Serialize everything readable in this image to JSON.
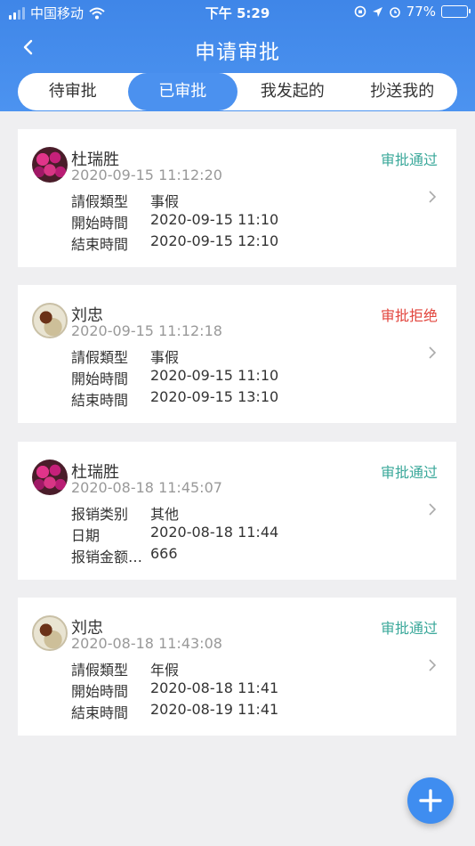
{
  "status_bar": {
    "carrier": "中国移动",
    "time": "下午 5:29",
    "battery": "77%",
    "battery_level": 0.77
  },
  "navbar": {
    "title": "申请审批"
  },
  "tabs": [
    {
      "label": "待审批",
      "active": false
    },
    {
      "label": "已审批",
      "active": true
    },
    {
      "label": "我发起的",
      "active": false
    },
    {
      "label": "抄送我的",
      "active": false
    }
  ],
  "cards": [
    {
      "name": "杜瑞胜",
      "time": "2020-09-15 11:12:20",
      "status": "审批通过",
      "status_type": "ok",
      "avatar": "flower",
      "rows": [
        {
          "k": "請假類型",
          "v": "事假"
        },
        {
          "k": "開始時間",
          "v": "2020-09-15 11:10"
        },
        {
          "k": "結束時間",
          "v": "2020-09-15 12:10"
        }
      ]
    },
    {
      "name": "刘忠",
      "time": "2020-09-15 11:12:18",
      "status": "审批拒绝",
      "status_type": "reject",
      "avatar": "dog",
      "rows": [
        {
          "k": "請假類型",
          "v": "事假"
        },
        {
          "k": "開始時間",
          "v": "2020-09-15 11:10"
        },
        {
          "k": "結束時間",
          "v": "2020-09-15 13:10"
        }
      ]
    },
    {
      "name": "杜瑞胜",
      "time": "2020-08-18 11:45:07",
      "status": "审批通过",
      "status_type": "ok",
      "avatar": "flower",
      "rows": [
        {
          "k": "报销类别",
          "v": "其他"
        },
        {
          "k": "日期",
          "v": "2020-08-18 11:44"
        },
        {
          "k": "报销金额…",
          "v": "666"
        }
      ]
    },
    {
      "name": "刘忠",
      "time": "2020-08-18 11:43:08",
      "status": "审批通过",
      "status_type": "ok",
      "avatar": "dog",
      "rows": [
        {
          "k": "請假類型",
          "v": "年假"
        },
        {
          "k": "開始時間",
          "v": "2020-08-18 11:41"
        },
        {
          "k": "結束時間",
          "v": "2020-08-19 11:41"
        }
      ]
    }
  ],
  "colors": {
    "primary": "#4b91ef",
    "approved": "#3aa89a",
    "rejected": "#e2453d"
  }
}
